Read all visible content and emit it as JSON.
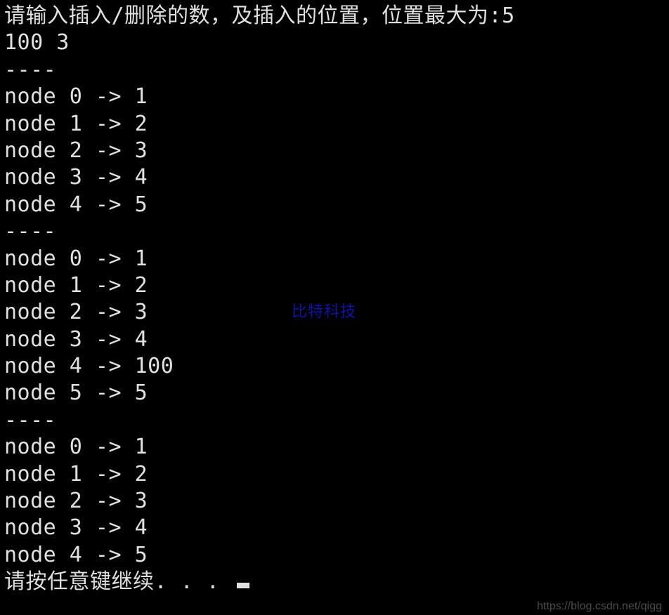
{
  "prompt_line": "请输入插入/删除的数，及插入的位置，位置最大为:5",
  "input_line": "100 3",
  "separator": "----",
  "blocks": [
    {
      "nodes": [
        {
          "index": 0,
          "value": 1
        },
        {
          "index": 1,
          "value": 2
        },
        {
          "index": 2,
          "value": 3
        },
        {
          "index": 3,
          "value": 4
        },
        {
          "index": 4,
          "value": 5
        }
      ]
    },
    {
      "nodes": [
        {
          "index": 0,
          "value": 1
        },
        {
          "index": 1,
          "value": 2
        },
        {
          "index": 2,
          "value": 3
        },
        {
          "index": 3,
          "value": 4
        },
        {
          "index": 4,
          "value": 100
        },
        {
          "index": 5,
          "value": 5
        }
      ]
    },
    {
      "nodes": [
        {
          "index": 0,
          "value": 1
        },
        {
          "index": 1,
          "value": 2
        },
        {
          "index": 2,
          "value": 3
        },
        {
          "index": 3,
          "value": 4
        },
        {
          "index": 4,
          "value": 5
        }
      ]
    }
  ],
  "continue_line": "请按任意键继续. . . ",
  "watermark": "比特科技",
  "footer": "https://blog.csdn.net/qigg"
}
